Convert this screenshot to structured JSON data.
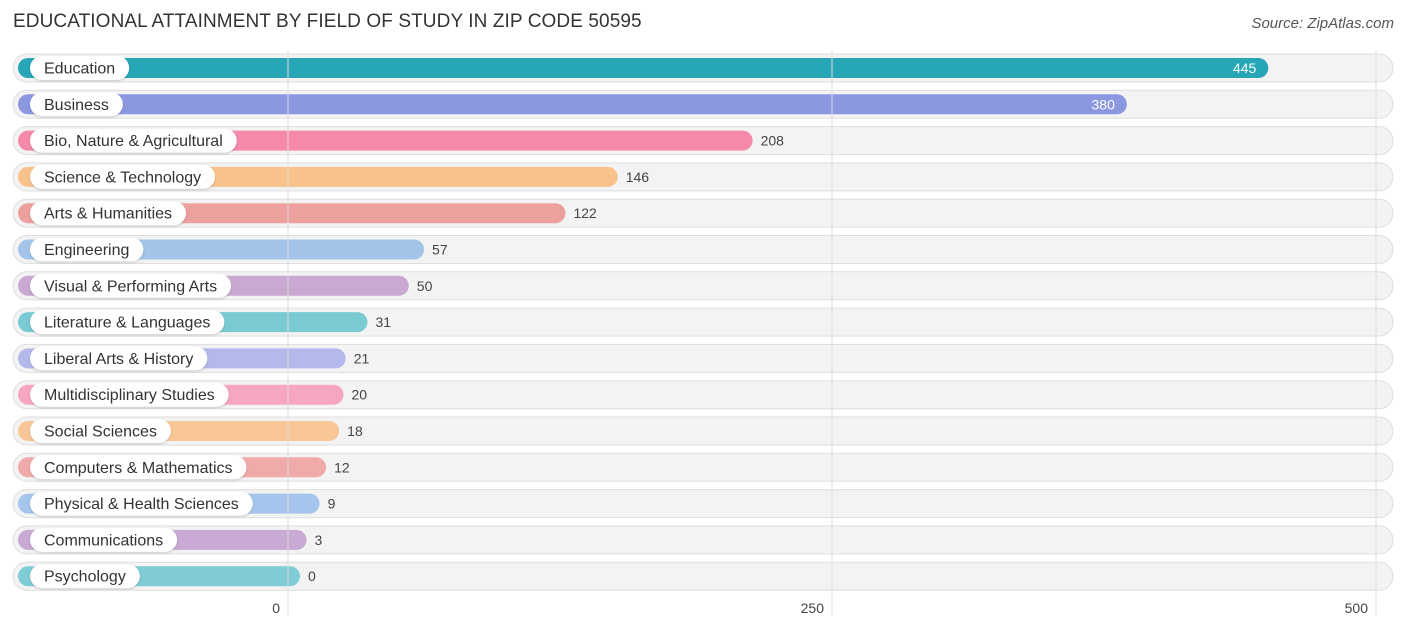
{
  "header": {
    "title": "EDUCATIONAL ATTAINMENT BY FIELD OF STUDY IN ZIP CODE 50595",
    "source": "Source: ZipAtlas.com"
  },
  "chart_data": {
    "type": "bar",
    "orientation": "horizontal",
    "title": "EDUCATIONAL ATTAINMENT BY FIELD OF STUDY IN ZIP CODE 50595",
    "xlabel": "",
    "ylabel": "",
    "xlim": [
      0,
      500
    ],
    "xticks": [
      0,
      250,
      500
    ],
    "xtick_labels": [
      "0",
      "250",
      "500"
    ],
    "grid": true,
    "categories": [
      "Education",
      "Business",
      "Bio, Nature & Agricultural",
      "Science & Technology",
      "Arts & Humanities",
      "Engineering",
      "Visual & Performing Arts",
      "Literature & Languages",
      "Liberal Arts & History",
      "Multidisciplinary Studies",
      "Social Sciences",
      "Computers & Mathematics",
      "Physical & Health Sciences",
      "Communications",
      "Psychology"
    ],
    "values": [
      445,
      380,
      208,
      146,
      122,
      57,
      50,
      31,
      21,
      20,
      18,
      12,
      9,
      3,
      0
    ],
    "value_labels": [
      "445",
      "380",
      "208",
      "146",
      "122",
      "57",
      "50",
      "31",
      "21",
      "20",
      "18",
      "12",
      "9",
      "3",
      "0"
    ],
    "colors": [
      "#27a6b6",
      "#8b98e0",
      "#f589aa",
      "#f9c28c",
      "#eda19f",
      "#a3c4e8",
      "#c9a8d1",
      "#79cad3",
      "#b3b9ea",
      "#f6a6c2",
      "#f9c797",
      "#f0aaa9",
      "#a5c5ec",
      "#c9aad4",
      "#80ccd6"
    ]
  }
}
